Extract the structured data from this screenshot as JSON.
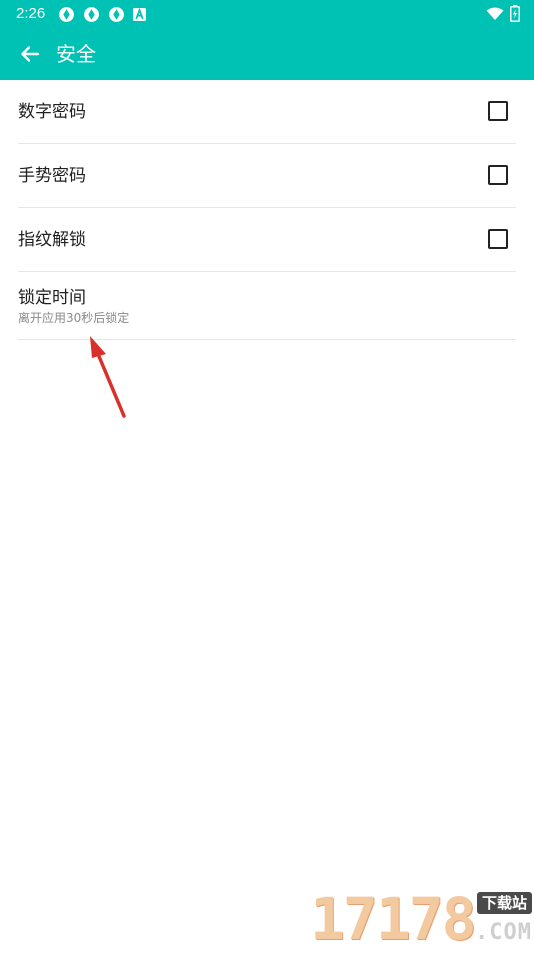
{
  "status_bar": {
    "time": "2:26",
    "left_icons": [
      "sync-icon",
      "sync-icon",
      "sync-icon",
      "a-badge-icon"
    ],
    "right_icons": [
      "wifi-icon",
      "battery-icon"
    ]
  },
  "header": {
    "title": "安全",
    "back_icon": "arrow-left-icon",
    "color": "#00c2b4"
  },
  "settings": {
    "items": [
      {
        "label": "数字密码",
        "checked": false
      },
      {
        "label": "手势密码",
        "checked": false
      },
      {
        "label": "指纹解锁",
        "checked": false
      },
      {
        "label": "锁定时间",
        "sublabel": "离开应用30秒后锁定"
      }
    ]
  },
  "watermark": {
    "digits": "17178",
    "tag": "下载站",
    "domain": ".COM"
  }
}
